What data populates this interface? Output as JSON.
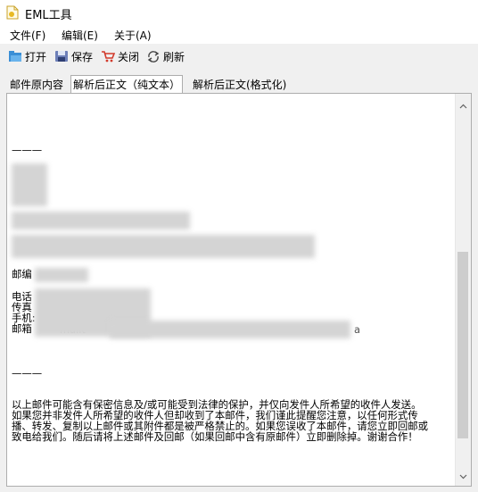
{
  "window": {
    "title": "EML工具"
  },
  "menu": {
    "file": "文件(F)",
    "edit": "编辑(E)",
    "about": "关于(A)"
  },
  "toolbar": {
    "open": "打开",
    "save": "保存",
    "close": "关闭",
    "refresh": "刷新"
  },
  "tabs": [
    {
      "label": "邮件原内容"
    },
    {
      "label": "解析后正文（纯文本）"
    },
    {
      "label": "解析后正文(格式化)"
    }
  ],
  "content": {
    "separator": "———",
    "postcode_label": "邮编",
    "phone_label": "电话",
    "fax_label": "传真",
    "mobile_label": "手机:",
    "email_label": "邮箱",
    "email_mailto": "mailt",
    "email_trailer": "a",
    "disclaimer": "以上邮件可能含有保密信息及/或可能受到法律的保护，并仅向发件人所希望的收件人发送。如果您并非发件人所希望的收件人但却收到了本邮件，我们谨此提醒您注意，以任何形式传播、转发、复制以上邮件或其附件都是被严格禁止的。如果您误收了本邮件，请您立即回邮或致电给我们。随后请将上述邮件及回邮（如果回邮中含有原邮件）立即删除掉。谢谢合作！"
  }
}
